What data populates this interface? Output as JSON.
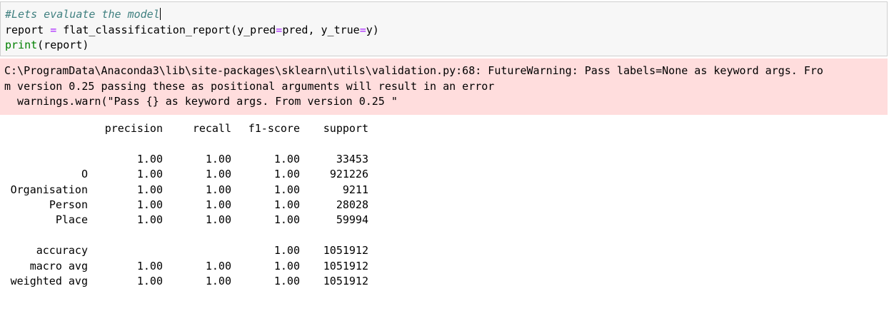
{
  "input_cell": {
    "comment": "#Lets evaluate the model",
    "line2": {
      "a": "report ",
      "eq": "=",
      "b": " flat_classification_report(y_pred",
      "eq2": "=",
      "c": "pred, y_true",
      "eq3": "=",
      "d": "y)"
    },
    "line3": {
      "builtin": "print",
      "rest": "(report)"
    }
  },
  "stderr": {
    "line1": "C:\\ProgramData\\Anaconda3\\lib\\site-packages\\sklearn\\utils\\validation.py:68: FutureWarning: Pass labels=None as keyword args. Fro",
    "line2": "m version 0.25 passing these as positional arguments will result in an error",
    "line3": "  warnings.warn(\"Pass {} as keyword args. From version 0.25 \""
  },
  "report": {
    "headers": [
      "",
      "precision",
      "recall",
      "f1-score",
      "support"
    ],
    "rows": [
      [
        "",
        "1.00",
        "1.00",
        "1.00",
        "33453"
      ],
      [
        "O",
        "1.00",
        "1.00",
        "1.00",
        "921226"
      ],
      [
        "Organisation",
        "1.00",
        "1.00",
        "1.00",
        "9211"
      ],
      [
        "Person",
        "1.00",
        "1.00",
        "1.00",
        "28028"
      ],
      [
        "Place",
        "1.00",
        "1.00",
        "1.00",
        "59994"
      ]
    ],
    "summary": [
      [
        "accuracy",
        "",
        "",
        "1.00",
        "1051912"
      ],
      [
        "macro avg",
        "1.00",
        "1.00",
        "1.00",
        "1051912"
      ],
      [
        "weighted avg",
        "1.00",
        "1.00",
        "1.00",
        "1051912"
      ]
    ]
  }
}
